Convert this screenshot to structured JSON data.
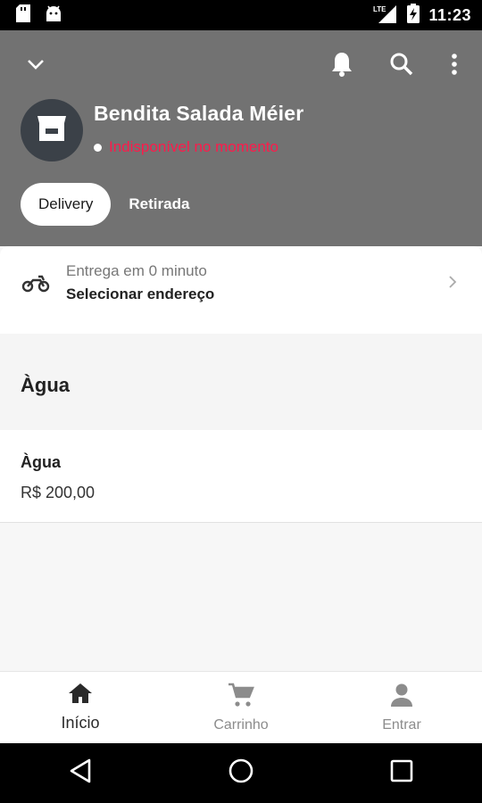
{
  "status_bar": {
    "time": "11:23",
    "network": "LTE"
  },
  "header": {
    "store_name": "Bendita Salada Méier",
    "status_text": "Indisponível no momento",
    "modes": [
      "Delivery",
      "Retirada"
    ],
    "colors": {
      "header_bg": "#727272",
      "status_red": "#ff1a4b"
    }
  },
  "delivery": {
    "subtitle": "Entrega em 0 minuto",
    "address_label": "Selecionar endereço"
  },
  "section": {
    "title": "Àgua"
  },
  "products": [
    {
      "name": "Àgua",
      "price": "R$ 200,00"
    }
  ],
  "bottom_nav": [
    {
      "label": "Início",
      "icon": "home-icon",
      "active": true
    },
    {
      "label": "Carrinho",
      "icon": "cart-icon",
      "active": false
    },
    {
      "label": "Entrar",
      "icon": "person-icon",
      "active": false
    }
  ]
}
